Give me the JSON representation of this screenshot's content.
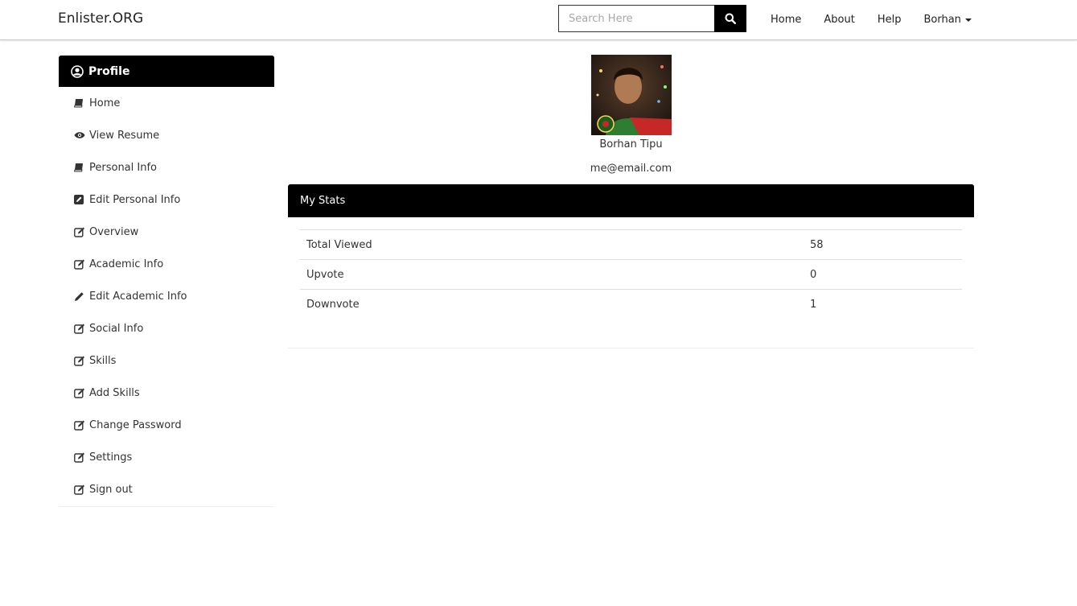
{
  "navbar": {
    "brand": "Enlister.ORG",
    "search_placeholder": "Search Here",
    "links": [
      "Home",
      "About",
      "Help"
    ],
    "user_menu": "Borhan"
  },
  "sidebar": {
    "header": "Profile",
    "items": [
      {
        "label": "Home",
        "icon": "book-icon"
      },
      {
        "label": "View Resume",
        "icon": "eye-icon"
      },
      {
        "label": "Personal Info",
        "icon": "book-icon"
      },
      {
        "label": "Edit Personal Info",
        "icon": "pencil-square-icon"
      },
      {
        "label": "Overview",
        "icon": "edit-icon"
      },
      {
        "label": "Academic Info",
        "icon": "edit-icon"
      },
      {
        "label": "Edit Academic Info",
        "icon": "pencil-icon"
      },
      {
        "label": "Social Info",
        "icon": "edit-icon"
      },
      {
        "label": "Skills",
        "icon": "edit-icon"
      },
      {
        "label": "Add Skills",
        "icon": "edit-icon"
      },
      {
        "label": "Change Password",
        "icon": "edit-icon"
      },
      {
        "label": "Settings",
        "icon": "edit-icon"
      },
      {
        "label": "Sign out",
        "icon": "edit-icon"
      }
    ]
  },
  "profile": {
    "name": "Borhan Tipu",
    "email": "me@email.com"
  },
  "stats": {
    "heading": "My Stats",
    "rows": [
      {
        "label": "Total Viewed",
        "value": "58"
      },
      {
        "label": "Upvote",
        "value": "0"
      },
      {
        "label": "Downvote",
        "value": "1"
      }
    ]
  },
  "colors": {
    "header_bg": "#000000",
    "text": "#333333"
  }
}
